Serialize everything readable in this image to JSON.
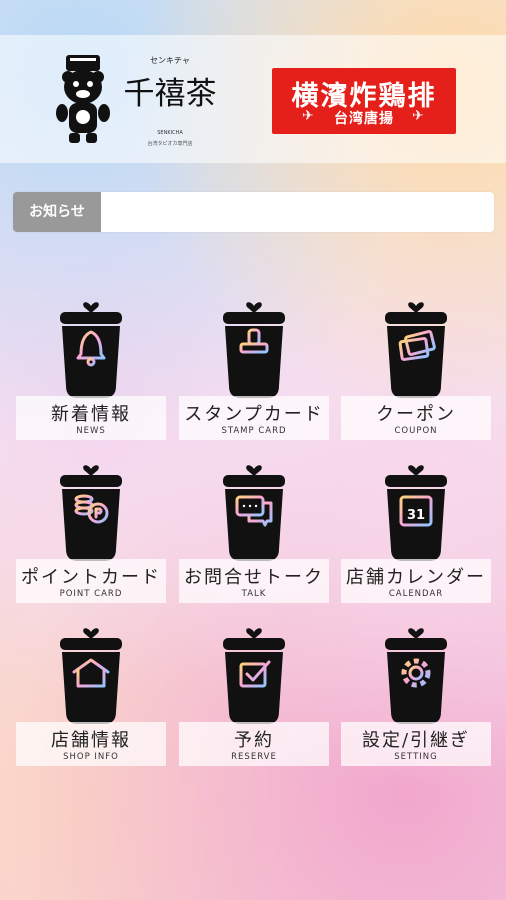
{
  "header": {
    "brand_kana": "センキチャ",
    "brand_kanji": "千禧茶",
    "brand_roman": "SENKICHA",
    "brand_sub": "台湾タピオカ専門店",
    "partner_title": "横濱炸鶏排",
    "partner_sub": "台湾唐揚",
    "partner_color": "#e5201b"
  },
  "news": {
    "label": "お知らせ",
    "value": ""
  },
  "menu": [
    {
      "jp": "新着情報",
      "en": "NEWS",
      "icon": "bell-icon"
    },
    {
      "jp": "スタンプカード",
      "en": "STAMP CARD",
      "icon": "stamp-icon"
    },
    {
      "jp": "クーポン",
      "en": "COUPON",
      "icon": "coupon-icon"
    },
    {
      "jp": "ポイントカード",
      "en": "POINT CARD",
      "icon": "coins-icon"
    },
    {
      "jp": "お問合せトーク",
      "en": "TALK",
      "icon": "chat-icon"
    },
    {
      "jp": "店舗カレンダー",
      "en": "CALENDAR",
      "icon": "calendar-icon"
    },
    {
      "jp": "店舗情報",
      "en": "SHOP INFO",
      "icon": "house-icon"
    },
    {
      "jp": "予約",
      "en": "RESERVE",
      "icon": "checkbox-icon"
    },
    {
      "jp": "設定/引継ぎ",
      "en": "SETTING",
      "icon": "gear-icon"
    }
  ],
  "calendar_day": "31"
}
